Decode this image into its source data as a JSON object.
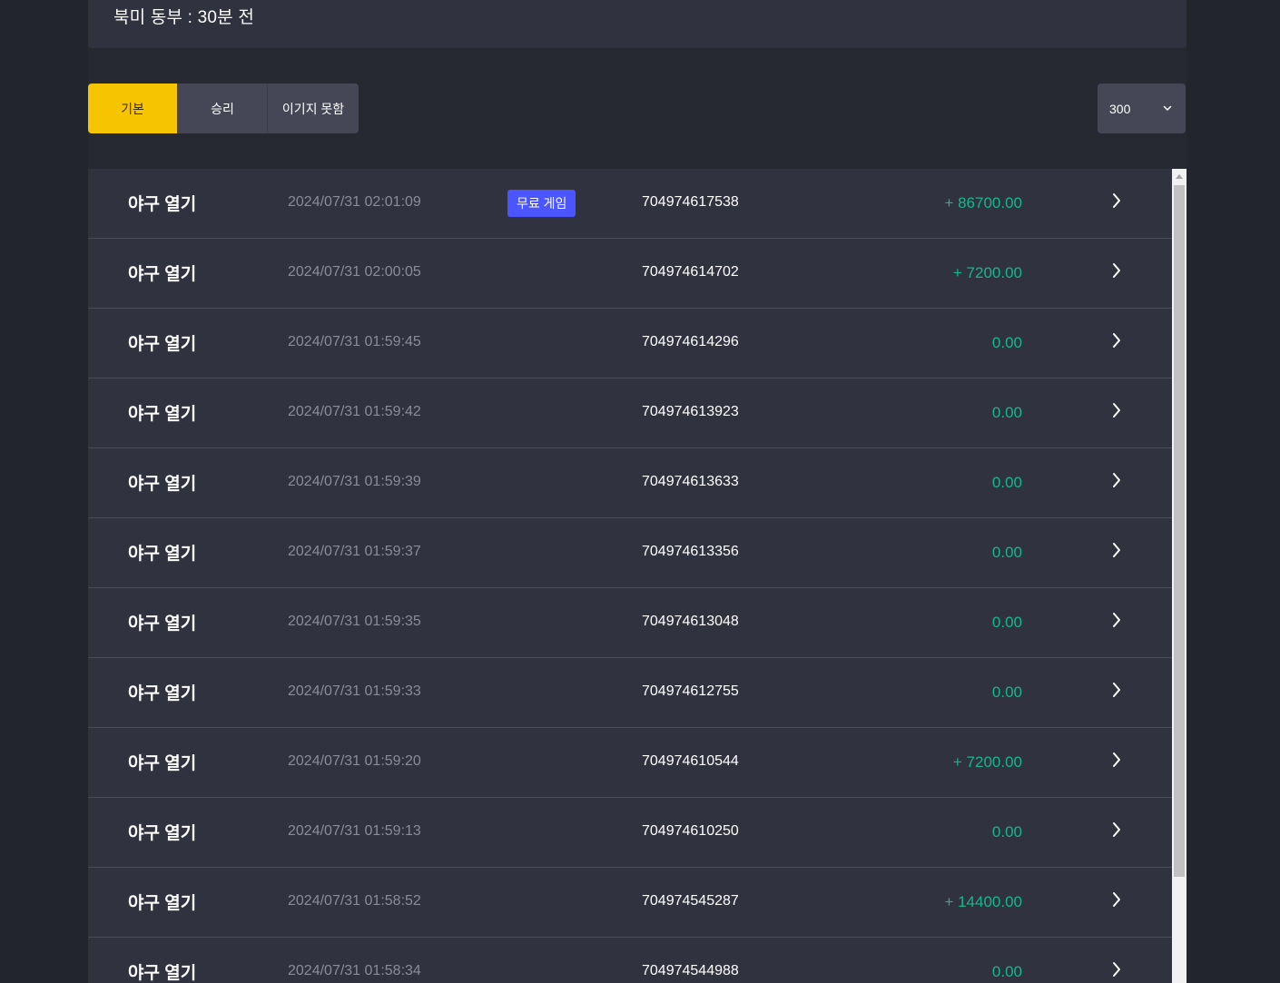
{
  "header": {
    "region_status": "북미 동부  : 30분 전"
  },
  "tabs": [
    {
      "label": "기본",
      "active": true
    },
    {
      "label": "승리",
      "active": false
    },
    {
      "label": "이기지 못함",
      "active": false
    }
  ],
  "page_size_select": {
    "value": "300",
    "icon": "chevron-down-icon"
  },
  "colors": {
    "accent": "#f6c400",
    "badge": "#4a55ff",
    "amount": "#15b88c",
    "row_bg": "#30323f"
  },
  "rows": [
    {
      "game": "야구 열기",
      "time": "2024/07/31 02:01:09",
      "badge": "무료 게임",
      "txid": "704974617538",
      "amount": "+ 86700.00"
    },
    {
      "game": "야구 열기",
      "time": "2024/07/31 02:00:05",
      "badge": "",
      "txid": "704974614702",
      "amount": "+ 7200.00"
    },
    {
      "game": "야구 열기",
      "time": "2024/07/31 01:59:45",
      "badge": "",
      "txid": "704974614296",
      "amount": "0.00"
    },
    {
      "game": "야구 열기",
      "time": "2024/07/31 01:59:42",
      "badge": "",
      "txid": "704974613923",
      "amount": "0.00"
    },
    {
      "game": "야구 열기",
      "time": "2024/07/31 01:59:39",
      "badge": "",
      "txid": "704974613633",
      "amount": "0.00"
    },
    {
      "game": "야구 열기",
      "time": "2024/07/31 01:59:37",
      "badge": "",
      "txid": "704974613356",
      "amount": "0.00"
    },
    {
      "game": "야구 열기",
      "time": "2024/07/31 01:59:35",
      "badge": "",
      "txid": "704974613048",
      "amount": "0.00"
    },
    {
      "game": "야구 열기",
      "time": "2024/07/31 01:59:33",
      "badge": "",
      "txid": "704974612755",
      "amount": "0.00"
    },
    {
      "game": "야구 열기",
      "time": "2024/07/31 01:59:20",
      "badge": "",
      "txid": "704974610544",
      "amount": "+ 7200.00"
    },
    {
      "game": "야구 열기",
      "time": "2024/07/31 01:59:13",
      "badge": "",
      "txid": "704974610250",
      "amount": "0.00"
    },
    {
      "game": "야구 열기",
      "time": "2024/07/31 01:58:52",
      "badge": "",
      "txid": "704974545287",
      "amount": "+ 14400.00"
    },
    {
      "game": "야구 열기",
      "time": "2024/07/31 01:58:34",
      "badge": "",
      "txid": "704974544988",
      "amount": "0.00"
    }
  ]
}
